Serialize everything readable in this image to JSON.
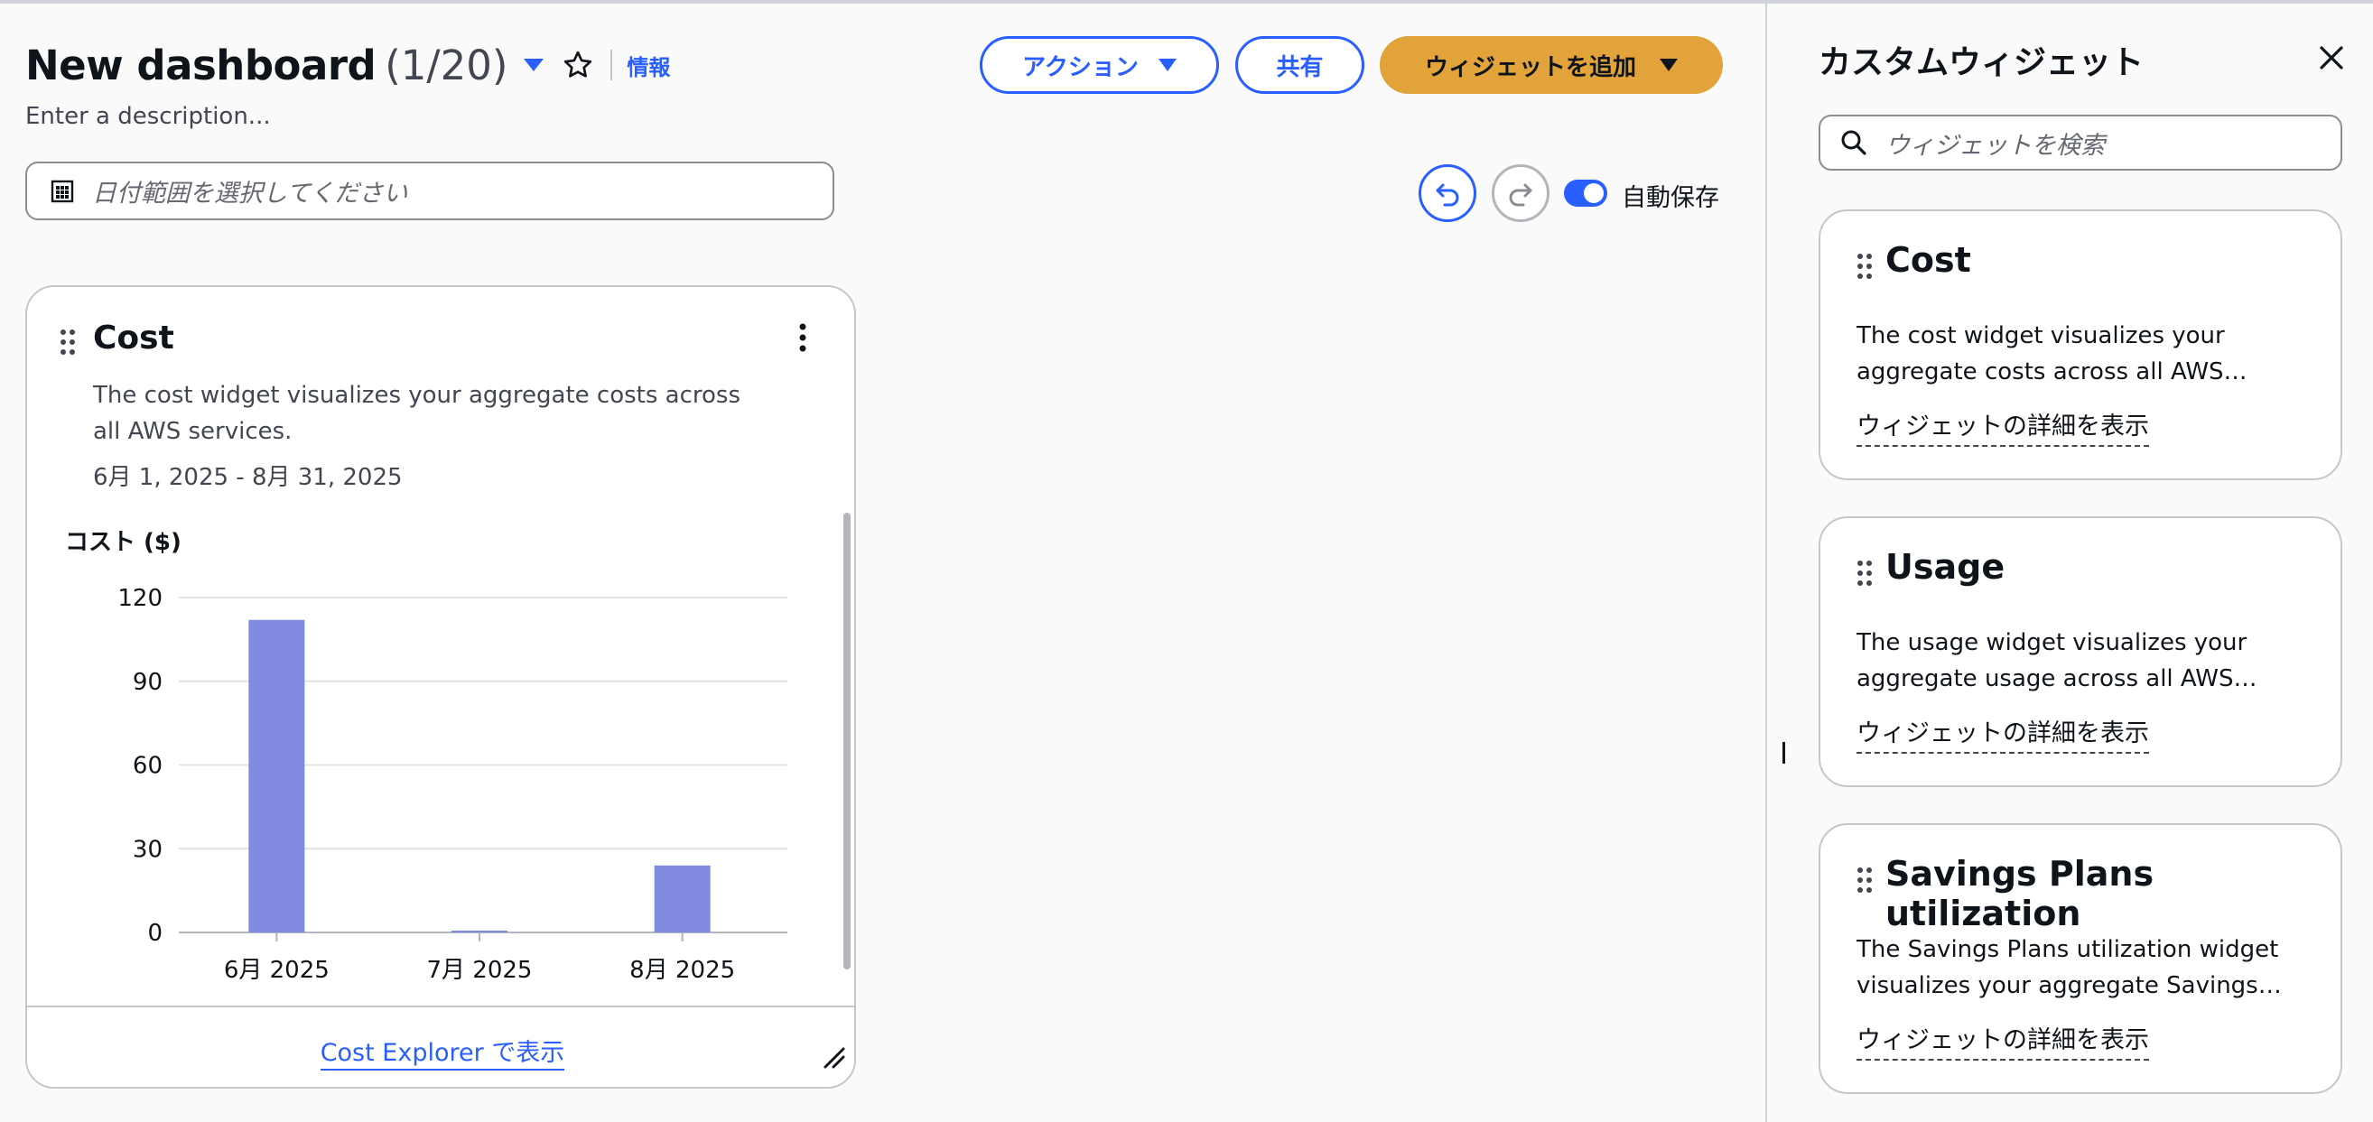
{
  "header": {
    "title": "New dashboard",
    "counter": "(1/20)",
    "info_label": "情報",
    "description_placeholder": "Enter a description...",
    "actions_label": "アクション",
    "share_label": "共有",
    "add_widget_label": "ウィジェットを追加"
  },
  "toolbar": {
    "date_placeholder": "日付範囲を選択してください",
    "autosave_label": "自動保存",
    "autosave_on": true
  },
  "widget": {
    "title": "Cost",
    "description_line1": "The cost widget visualizes your aggregate costs across",
    "description_line2": "all AWS services.",
    "date_range": "6月 1, 2025 - 8月 31, 2025",
    "chart_title": "コスト ($)",
    "footer_link": "Cost Explorer で表示"
  },
  "chart_data": {
    "type": "bar",
    "title": "コスト ($)",
    "categories": [
      "6月 2025",
      "7月 2025",
      "8月 2025"
    ],
    "values": [
      112,
      0.5,
      24
    ],
    "yticks": [
      0,
      30,
      60,
      90,
      120
    ],
    "ylim": [
      0,
      120
    ],
    "grid": true,
    "bar_color": "#7f8ae0"
  },
  "panel": {
    "title": "カスタムウィジェット",
    "search_placeholder": "ウィジェットを検索",
    "cards": [
      {
        "title": "Cost",
        "desc_line1": "The cost widget visualizes your",
        "desc_line2": "aggregate costs across all AWS…",
        "link": "ウィジェットの詳細を表示"
      },
      {
        "title": "Usage",
        "desc_line1": "The usage widget visualizes your",
        "desc_line2": "aggregate usage across all AWS…",
        "link": "ウィジェットの詳細を表示"
      },
      {
        "title": "Savings Plans utilization",
        "desc_line1": "The Savings Plans utilization widget",
        "desc_line2": "visualizes your aggregate Savings…",
        "link": "ウィジェットの詳細を表示"
      }
    ]
  },
  "colors": {
    "accent": "#295eff",
    "primary_button": "#e2a33a",
    "bar": "#7f8ae0"
  }
}
